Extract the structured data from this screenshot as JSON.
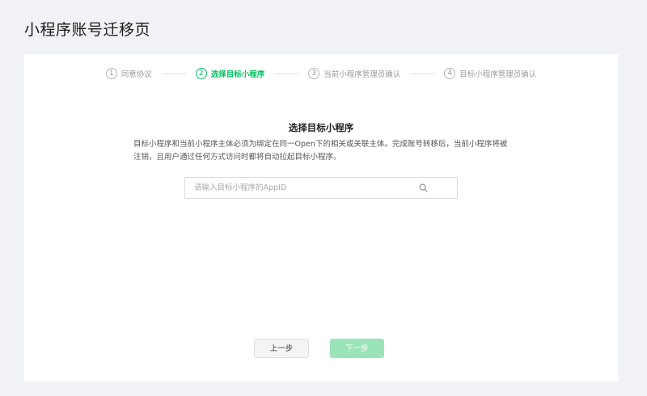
{
  "page": {
    "title": "小程序账号迁移页"
  },
  "steps": [
    {
      "number": "1",
      "label": "同意协议"
    },
    {
      "number": "2",
      "label": "选择目标小程序"
    },
    {
      "number": "3",
      "label": "当前小程序管理员确认"
    },
    {
      "number": "4",
      "label": "目标小程序管理员确认"
    }
  ],
  "active_step": 2,
  "content": {
    "title": "选择目标小程序",
    "description": "目标小程序和当前小程序主体必须为绑定在同一Open下的相关或关联主体。完成账号转移后，当前小程序将被注销，且用户通过任何方式访问时都将自动拉起目标小程序。"
  },
  "search": {
    "placeholder": "请输入目标小程序的AppID",
    "value": ""
  },
  "buttons": {
    "prev_label": "上一步",
    "next_label": "下一步"
  },
  "colors": {
    "accent": "#07c160",
    "next_disabled": "#9be3b8"
  }
}
